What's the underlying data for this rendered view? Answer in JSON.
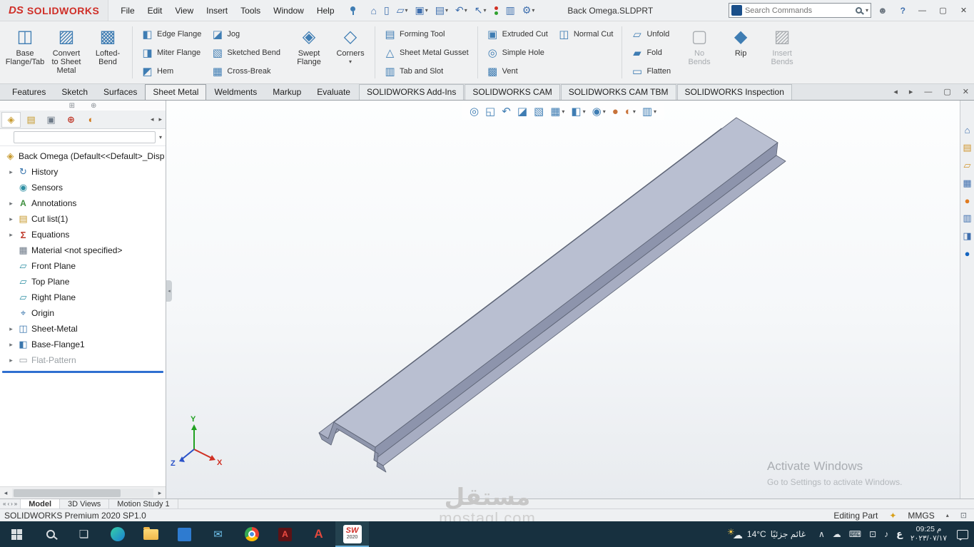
{
  "titlebar": {
    "logo_mark": "DS",
    "logo_text": "SOLIDWORKS",
    "menus": [
      "File",
      "Edit",
      "View",
      "Insert",
      "Tools",
      "Window",
      "Help"
    ],
    "document_title": "Back Omega.SLDPRT",
    "search_placeholder": "Search Commands",
    "help_label": "?",
    "window_controls": {
      "minimize": "—",
      "maximize": "▢",
      "close": "✕"
    }
  },
  "quick_toolbar": [
    {
      "name": "home",
      "glyph": "⌂"
    },
    {
      "name": "new-document",
      "glyph": "▯"
    },
    {
      "name": "open",
      "glyph": "▱"
    },
    {
      "name": "save",
      "glyph": "▣"
    },
    {
      "name": "print",
      "glyph": "▤"
    },
    {
      "name": "undo",
      "glyph": "↶"
    },
    {
      "name": "select",
      "glyph": "↖"
    },
    {
      "name": "record-indicator",
      "glyph": ""
    },
    {
      "name": "task-list",
      "glyph": "▥"
    },
    {
      "name": "options",
      "glyph": "⚙"
    }
  ],
  "ribbon": {
    "groups": [
      {
        "buttons": [
          {
            "label": "Base\nFlange/Tab"
          },
          {
            "label": "Convert\nto Sheet\nMetal"
          },
          {
            "label": "Lofted-Bend"
          }
        ]
      },
      {
        "buttons": [
          {
            "label": "Edge Flange"
          },
          {
            "label": "Miter Flange"
          },
          {
            "label": "Hem"
          }
        ]
      },
      {
        "buttons": [
          {
            "label": "Jog"
          },
          {
            "label": "Sketched Bend"
          },
          {
            "label": "Cross-Break"
          }
        ]
      },
      {
        "buttons": [
          {
            "label": "Swept\nFlange"
          }
        ]
      },
      {
        "buttons": [
          {
            "label": "Corners"
          }
        ]
      },
      {
        "buttons": [
          {
            "label": "Forming Tool"
          },
          {
            "label": "Sheet Metal Gusset"
          },
          {
            "label": "Tab and Slot"
          }
        ]
      },
      {
        "buttons": [
          {
            "label": "Extruded Cut"
          },
          {
            "label": "Simple Hole"
          },
          {
            "label": "Vent"
          }
        ]
      },
      {
        "buttons": [
          {
            "label": "Normal Cut"
          }
        ]
      },
      {
        "buttons": [
          {
            "label": "Unfold"
          },
          {
            "label": "Fold"
          },
          {
            "label": "Flatten"
          }
        ]
      },
      {
        "buttons": [
          {
            "label": "No\nBends",
            "disabled": true
          },
          {
            "label": "Rip"
          },
          {
            "label": "Insert\nBends",
            "disabled": true
          }
        ]
      }
    ]
  },
  "command_tabs": [
    {
      "label": "Features"
    },
    {
      "label": "Sketch"
    },
    {
      "label": "Surfaces"
    },
    {
      "label": "Sheet Metal",
      "active": true
    },
    {
      "label": "Weldments"
    },
    {
      "label": "Markup"
    },
    {
      "label": "Evaluate"
    },
    {
      "label": "SOLIDWORKS Add-Ins"
    },
    {
      "label": "SOLIDWORKS CAM"
    },
    {
      "label": "SOLIDWORKS CAM TBM"
    },
    {
      "label": "SOLIDWORKS Inspection"
    }
  ],
  "feature_tree": {
    "root_label": "Back Omega  (Default<<Default>_Disp",
    "items": [
      {
        "label": "History",
        "expandable": true
      },
      {
        "label": "Sensors",
        "expandable": false
      },
      {
        "label": "Annotations",
        "expandable": true
      },
      {
        "label": "Cut list(1)",
        "expandable": true
      },
      {
        "label": "Equations",
        "expandable": true
      },
      {
        "label": "Material <not specified>",
        "expandable": false
      },
      {
        "label": "Front Plane",
        "expandable": false
      },
      {
        "label": "Top Plane",
        "expandable": false
      },
      {
        "label": "Right Plane",
        "expandable": false
      },
      {
        "label": "Origin",
        "expandable": false
      },
      {
        "label": "Sheet-Metal",
        "expandable": true
      },
      {
        "label": "Base-Flange1",
        "expandable": true
      },
      {
        "label": "Flat-Pattern",
        "expandable": true,
        "suppressed": true
      }
    ]
  },
  "headsup": [
    {
      "name": "zoom-to-fit",
      "glyph": "◎"
    },
    {
      "name": "zoom-to-area",
      "glyph": "◱"
    },
    {
      "name": "previous-view",
      "glyph": "↶"
    },
    {
      "name": "section-view",
      "glyph": "◪"
    },
    {
      "name": "dynamic-annotation-views",
      "glyph": "▧"
    },
    {
      "name": "view-orientation",
      "glyph": "▦",
      "dropdown": true
    },
    {
      "name": "display-style",
      "glyph": "◧",
      "dropdown": true
    },
    {
      "name": "hide-show-items",
      "glyph": "◉",
      "dropdown": true
    },
    {
      "name": "edit-appearance",
      "glyph": "●"
    },
    {
      "name": "apply-scene",
      "glyph": "◐",
      "dropdown": true
    },
    {
      "name": "view-settings",
      "glyph": "▥",
      "dropdown": true
    }
  ],
  "task_pane": [
    {
      "name": "solidworks-resources",
      "glyph": "⌂"
    },
    {
      "name": "design-library",
      "glyph": "▤"
    },
    {
      "name": "file-explorer",
      "glyph": "▱"
    },
    {
      "name": "view-palette",
      "glyph": "▦"
    },
    {
      "name": "appearances-scenes",
      "glyph": "●"
    },
    {
      "name": "custom-properties",
      "glyph": "▥"
    },
    {
      "name": "solidworks-cam",
      "glyph": "◨"
    },
    {
      "name": "3dexperience",
      "glyph": "●"
    }
  ],
  "viewport": {
    "triad": {
      "x": "X",
      "y": "Y",
      "z": "Z"
    },
    "activate": {
      "line1": "Activate Windows",
      "line2": "Go to Settings to activate Windows."
    },
    "watermark": {
      "arabic": "مستقل",
      "latin": "mostaql.com"
    }
  },
  "model_tabs": [
    {
      "label": "Model",
      "active": true
    },
    {
      "label": "3D Views"
    },
    {
      "label": "Motion Study 1"
    }
  ],
  "statusbar": {
    "left": "SOLIDWORKS Premium 2020 SP1.0",
    "editing": "Editing Part",
    "units": "MMGS"
  },
  "taskbar": {
    "weather": {
      "temp": "14°C",
      "desc": "غائم جزئيًا"
    },
    "sw_logo": "SW",
    "sw_year": "2020",
    "language": "ع",
    "clock": {
      "time": "09:25 م",
      "date": "٢٠٢٣/٠٧/١٧"
    },
    "tray": [
      {
        "name": "hidden-icons",
        "glyph": "∧"
      },
      {
        "name": "onedrive",
        "glyph": "☁"
      },
      {
        "name": "touch-keyboard",
        "glyph": "⌨"
      },
      {
        "name": "display",
        "glyph": "⊡"
      },
      {
        "name": "volume",
        "glyph": "♪"
      }
    ]
  },
  "colors": {
    "accent": "#2f6fd0",
    "brand_red": "#cf2e27",
    "model_face": "#b9bfd1",
    "taskbar_bg": "#17303f"
  }
}
